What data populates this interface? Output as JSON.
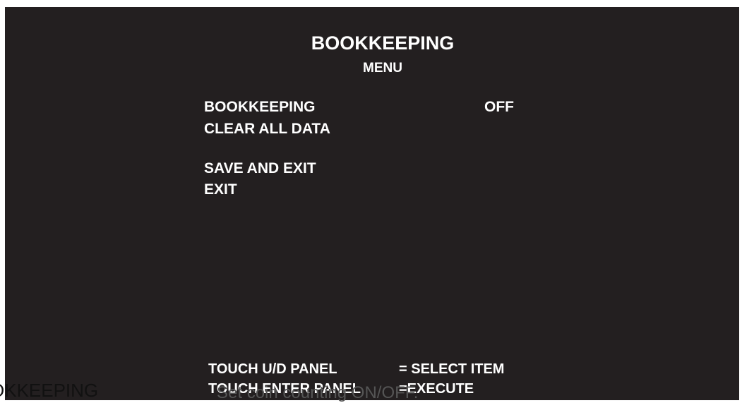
{
  "colors": {
    "screen_background": "#231f20",
    "text": "#ffffff",
    "page_background": "#ffffff"
  },
  "header": {
    "title": "BOOKKEEPING",
    "subtitle": "MENU"
  },
  "menu": {
    "items": [
      {
        "label": "BOOKKEEPING",
        "value": "OFF"
      },
      {
        "label": "CLEAR ALL DATA"
      },
      {
        "label": "SAVE AND EXIT"
      },
      {
        "label": "EXIT"
      }
    ]
  },
  "help": {
    "lines": [
      {
        "control": "TOUCH U/D PANEL",
        "action": "= SELECT ITEM"
      },
      {
        "control": "TOUCH ENTER PANEL",
        "action": "=EXECUTE"
      }
    ]
  },
  "overlay": {
    "left_text": "OKKEEPING",
    "caption": "Set coin counting ON/OFF."
  }
}
